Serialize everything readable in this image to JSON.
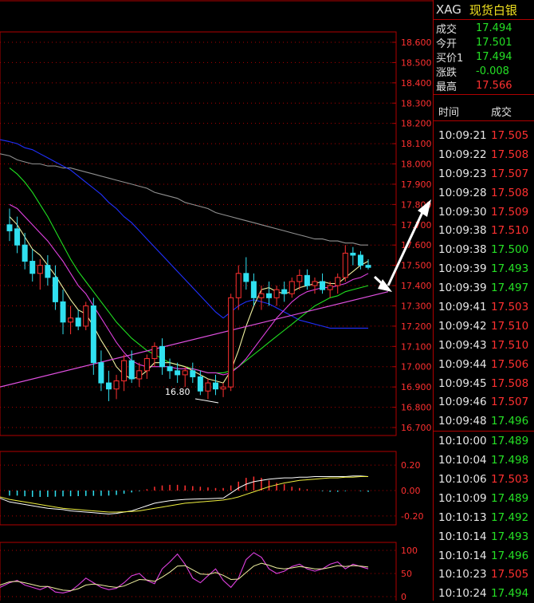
{
  "header": {
    "symbol": "XAG",
    "name": "现货白银"
  },
  "quote": [
    {
      "label": "成交",
      "value": "17.494",
      "color": "green"
    },
    {
      "label": "今开",
      "value": "17.501",
      "color": "green"
    },
    {
      "label": "买价1",
      "value": "17.494",
      "color": "green"
    },
    {
      "label": "涨跌",
      "value": "-0.008",
      "color": "green"
    },
    {
      "label": "最高",
      "value": "17.566",
      "color": "red"
    }
  ],
  "ticks_header": {
    "time": "时间",
    "price": "成交"
  },
  "ticks": [
    {
      "time": "10:09:21",
      "price": "17.505",
      "color": "red"
    },
    {
      "time": "10:09:22",
      "price": "17.508",
      "color": "red"
    },
    {
      "time": "10:09:23",
      "price": "17.507",
      "color": "red"
    },
    {
      "time": "10:09:28",
      "price": "17.508",
      "color": "red"
    },
    {
      "time": "10:09:30",
      "price": "17.509",
      "color": "red"
    },
    {
      "time": "10:09:38",
      "price": "17.510",
      "color": "red"
    },
    {
      "time": "10:09:38",
      "price": "17.500",
      "color": "green"
    },
    {
      "time": "10:09:39",
      "price": "17.493",
      "color": "green"
    },
    {
      "time": "10:09:39",
      "price": "17.497",
      "color": "green"
    },
    {
      "time": "10:09:41",
      "price": "17.503",
      "color": "red"
    },
    {
      "time": "10:09:42",
      "price": "17.510",
      "color": "red"
    },
    {
      "time": "10:09:43",
      "price": "17.510",
      "color": "red"
    },
    {
      "time": "10:09:44",
      "price": "17.506",
      "color": "red"
    },
    {
      "time": "10:09:45",
      "price": "17.508",
      "color": "red"
    },
    {
      "time": "10:09:46",
      "price": "17.507",
      "color": "red"
    },
    {
      "time": "10:09:48",
      "price": "17.496",
      "color": "green"
    },
    {
      "time": "10:10:00",
      "price": "17.489",
      "color": "green"
    },
    {
      "time": "10:10:04",
      "price": "17.498",
      "color": "green"
    },
    {
      "time": "10:10:06",
      "price": "17.503",
      "color": "red"
    },
    {
      "time": "10:10:09",
      "price": "17.489",
      "color": "green"
    },
    {
      "time": "10:10:13",
      "price": "17.492",
      "color": "green"
    },
    {
      "time": "10:10:14",
      "price": "17.493",
      "color": "green"
    },
    {
      "time": "10:10:14",
      "price": "17.496",
      "color": "green"
    },
    {
      "time": "10:10:23",
      "price": "17.505",
      "color": "red"
    },
    {
      "time": "10:10:24",
      "price": "17.494",
      "color": "green"
    }
  ],
  "price_axis": [
    "18.600",
    "18.500",
    "18.400",
    "18.300",
    "18.200",
    "18.100",
    "18.000",
    "17.900",
    "17.800",
    "17.700",
    "17.600",
    "17.500",
    "17.400",
    "17.300",
    "17.200",
    "17.100",
    "17.000",
    "16.900",
    "16.800",
    "16.700"
  ],
  "low_label": "16.80",
  "macd_axis": [
    "0.20",
    "0.00",
    "-0.20"
  ],
  "kdj_axis": [
    "100",
    "50",
    "0"
  ],
  "colors": {
    "up": "#ff3030",
    "down": "#30e0f0",
    "grid": "#b00000",
    "ma5": "#f0f0a0",
    "ma10": "#e040e0",
    "ma20": "#20e020",
    "ma60": "#2030ff",
    "ma120": "#909090"
  },
  "chart_data": {
    "type": "candlestick",
    "ylim": [
      16.7,
      18.65
    ],
    "candles": [
      {
        "o": 17.7,
        "h": 17.78,
        "l": 17.62,
        "c": 17.67
      },
      {
        "o": 17.68,
        "h": 17.74,
        "l": 17.56,
        "c": 17.6
      },
      {
        "o": 17.6,
        "h": 17.66,
        "l": 17.48,
        "c": 17.52
      },
      {
        "o": 17.52,
        "h": 17.58,
        "l": 17.42,
        "c": 17.46
      },
      {
        "o": 17.46,
        "h": 17.53,
        "l": 17.38,
        "c": 17.5
      },
      {
        "o": 17.5,
        "h": 17.55,
        "l": 17.4,
        "c": 17.44
      },
      {
        "o": 17.44,
        "h": 17.5,
        "l": 17.28,
        "c": 17.32
      },
      {
        "o": 17.32,
        "h": 17.38,
        "l": 17.16,
        "c": 17.22
      },
      {
        "o": 17.22,
        "h": 17.3,
        "l": 17.16,
        "c": 17.24
      },
      {
        "o": 17.24,
        "h": 17.28,
        "l": 17.18,
        "c": 17.2
      },
      {
        "o": 17.2,
        "h": 17.32,
        "l": 17.18,
        "c": 17.3
      },
      {
        "o": 17.3,
        "h": 17.34,
        "l": 16.96,
        "c": 17.02
      },
      {
        "o": 17.02,
        "h": 17.08,
        "l": 16.88,
        "c": 16.92
      },
      {
        "o": 16.92,
        "h": 16.98,
        "l": 16.83,
        "c": 16.89
      },
      {
        "o": 16.89,
        "h": 16.96,
        "l": 16.84,
        "c": 16.93
      },
      {
        "o": 16.93,
        "h": 17.06,
        "l": 16.88,
        "c": 17.03
      },
      {
        "o": 17.03,
        "h": 17.08,
        "l": 16.92,
        "c": 16.94
      },
      {
        "o": 16.94,
        "h": 17.02,
        "l": 16.9,
        "c": 16.98
      },
      {
        "o": 16.98,
        "h": 17.06,
        "l": 16.94,
        "c": 17.04
      },
      {
        "o": 17.04,
        "h": 17.12,
        "l": 17.0,
        "c": 17.1
      },
      {
        "o": 17.1,
        "h": 17.14,
        "l": 16.96,
        "c": 17.0
      },
      {
        "o": 17.0,
        "h": 17.04,
        "l": 16.94,
        "c": 16.98
      },
      {
        "o": 16.98,
        "h": 17.02,
        "l": 16.92,
        "c": 16.96
      },
      {
        "o": 16.96,
        "h": 17.0,
        "l": 16.9,
        "c": 16.98
      },
      {
        "o": 16.98,
        "h": 17.02,
        "l": 16.92,
        "c": 16.95
      },
      {
        "o": 16.95,
        "h": 16.98,
        "l": 16.86,
        "c": 16.88
      },
      {
        "o": 16.88,
        "h": 16.94,
        "l": 16.84,
        "c": 16.92
      },
      {
        "o": 16.92,
        "h": 16.96,
        "l": 16.86,
        "c": 16.89
      },
      {
        "o": 16.89,
        "h": 16.92,
        "l": 16.85,
        "c": 16.9
      },
      {
        "o": 16.9,
        "h": 17.36,
        "l": 16.88,
        "c": 17.34
      },
      {
        "o": 17.34,
        "h": 17.5,
        "l": 17.28,
        "c": 17.46
      },
      {
        "o": 17.46,
        "h": 17.54,
        "l": 17.38,
        "c": 17.42
      },
      {
        "o": 17.42,
        "h": 17.46,
        "l": 17.3,
        "c": 17.34
      },
      {
        "o": 17.34,
        "h": 17.4,
        "l": 17.28,
        "c": 17.36
      },
      {
        "o": 17.36,
        "h": 17.42,
        "l": 17.3,
        "c": 17.34
      },
      {
        "o": 17.34,
        "h": 17.4,
        "l": 17.3,
        "c": 17.38
      },
      {
        "o": 17.38,
        "h": 17.42,
        "l": 17.32,
        "c": 17.36
      },
      {
        "o": 17.36,
        "h": 17.44,
        "l": 17.34,
        "c": 17.42
      },
      {
        "o": 17.42,
        "h": 17.48,
        "l": 17.38,
        "c": 17.45
      },
      {
        "o": 17.45,
        "h": 17.48,
        "l": 17.38,
        "c": 17.4
      },
      {
        "o": 17.4,
        "h": 17.44,
        "l": 17.36,
        "c": 17.42
      },
      {
        "o": 17.42,
        "h": 17.46,
        "l": 17.36,
        "c": 17.38
      },
      {
        "o": 17.38,
        "h": 17.42,
        "l": 17.34,
        "c": 17.4
      },
      {
        "o": 17.4,
        "h": 17.46,
        "l": 17.36,
        "c": 17.44
      },
      {
        "o": 17.44,
        "h": 17.6,
        "l": 17.42,
        "c": 17.56
      },
      {
        "o": 17.56,
        "h": 17.59,
        "l": 17.5,
        "c": 17.55
      },
      {
        "o": 17.55,
        "h": 17.57,
        "l": 17.48,
        "c": 17.5
      },
      {
        "o": 17.5,
        "h": 17.53,
        "l": 17.48,
        "c": 17.49
      }
    ],
    "ma5": [
      17.74,
      17.7,
      17.64,
      17.58,
      17.55,
      17.5,
      17.45,
      17.39,
      17.33,
      17.28,
      17.26,
      17.2,
      17.13,
      17.07,
      17.0,
      16.96,
      16.94,
      16.95,
      16.98,
      17.02,
      17.02,
      17.02,
      17.01,
      17.0,
      16.98,
      16.96,
      16.94,
      16.93,
      16.92,
      16.98,
      17.08,
      17.2,
      17.3,
      17.38,
      17.39,
      17.37,
      17.36,
      17.37,
      17.39,
      17.4,
      17.41,
      17.42,
      17.41,
      17.41,
      17.44,
      17.47,
      17.5,
      17.52
    ],
    "ma10": [
      17.8,
      17.78,
      17.74,
      17.7,
      17.66,
      17.62,
      17.57,
      17.52,
      17.46,
      17.4,
      17.36,
      17.3,
      17.24,
      17.18,
      17.12,
      17.07,
      17.03,
      17.01,
      17.0,
      17.0,
      17.0,
      17.0,
      16.99,
      16.99,
      16.99,
      16.98,
      16.97,
      16.97,
      16.96,
      16.97,
      17.0,
      17.04,
      17.09,
      17.14,
      17.19,
      17.24,
      17.28,
      17.32,
      17.35,
      17.37,
      17.38,
      17.39,
      17.39,
      17.4,
      17.41,
      17.43,
      17.44,
      17.46
    ],
    "ma20": [
      17.98,
      17.95,
      17.91,
      17.86,
      17.8,
      17.74,
      17.67,
      17.6,
      17.53,
      17.47,
      17.42,
      17.37,
      17.32,
      17.27,
      17.22,
      17.18,
      17.14,
      17.11,
      17.08,
      17.06,
      17.04,
      17.02,
      17.01,
      17.0,
      16.99,
      16.98,
      16.97,
      16.97,
      16.97,
      16.98,
      17.0,
      17.03,
      17.06,
      17.09,
      17.12,
      17.15,
      17.18,
      17.21,
      17.24,
      17.27,
      17.3,
      17.32,
      17.34,
      17.35,
      17.37,
      17.38,
      17.39,
      17.4
    ],
    "ma60": [
      18.11,
      18.1,
      18.08,
      18.07,
      18.05,
      18.03,
      18.01,
      17.99,
      17.97,
      17.94,
      17.91,
      17.88,
      17.85,
      17.81,
      17.78,
      17.74,
      17.71,
      17.67,
      17.63,
      17.59,
      17.55,
      17.51,
      17.47,
      17.43,
      17.39,
      17.35,
      17.31,
      17.27,
      17.24,
      17.27,
      17.3,
      17.32,
      17.33,
      17.32,
      17.31,
      17.29,
      17.27,
      17.25,
      17.23,
      17.22,
      17.21,
      17.2,
      17.19,
      17.19,
      17.19,
      17.19,
      17.19,
      17.19
    ],
    "ma120": [
      18.04,
      18.02,
      18.01,
      18.0,
      18.0,
      17.99,
      17.99,
      17.98,
      17.98,
      17.97,
      17.96,
      17.95,
      17.94,
      17.93,
      17.92,
      17.91,
      17.9,
      17.89,
      17.88,
      17.86,
      17.85,
      17.84,
      17.83,
      17.81,
      17.8,
      17.79,
      17.78,
      17.76,
      17.75,
      17.74,
      17.73,
      17.72,
      17.71,
      17.7,
      17.69,
      17.68,
      17.67,
      17.66,
      17.65,
      17.64,
      17.63,
      17.63,
      17.62,
      17.62,
      17.61,
      17.61,
      17.6,
      17.6
    ],
    "trendline": [
      [
        16.9,
        17.4
      ]
    ],
    "macd_hist": [
      -0.04,
      -0.04,
      -0.045,
      -0.05,
      -0.05,
      -0.05,
      -0.048,
      -0.046,
      -0.045,
      -0.044,
      -0.043,
      -0.042,
      -0.042,
      -0.04,
      -0.035,
      -0.025,
      -0.015,
      -0.005,
      0.01,
      0.03,
      0.04,
      0.045,
      0.045,
      0.04,
      0.035,
      0.03,
      0.025,
      0.02,
      0.02,
      0.04,
      0.07,
      0.1,
      0.11,
      0.1,
      0.08,
      0.06,
      0.05,
      0.03,
      0.02,
      0.01,
      0.0,
      -0.005,
      -0.01,
      -0.01,
      -0.005,
      0.0,
      -0.005,
      -0.01
    ],
    "macd_dif": [
      -0.09,
      -0.1,
      -0.11,
      -0.12,
      -0.13,
      -0.14,
      -0.145,
      -0.15,
      -0.16,
      -0.165,
      -0.17,
      -0.175,
      -0.18,
      -0.185,
      -0.18,
      -0.17,
      -0.16,
      -0.14,
      -0.12,
      -0.1,
      -0.09,
      -0.08,
      -0.075,
      -0.07,
      -0.068,
      -0.066,
      -0.064,
      -0.062,
      -0.06,
      -0.02,
      0.02,
      0.05,
      0.07,
      0.08,
      0.09,
      0.095,
      0.1,
      0.1,
      0.105,
      0.105,
      0.11,
      0.11,
      0.11,
      0.11,
      0.11,
      0.115,
      0.115,
      0.11
    ],
    "macd_dea": [
      -0.07,
      -0.08,
      -0.09,
      -0.1,
      -0.11,
      -0.12,
      -0.13,
      -0.14,
      -0.145,
      -0.15,
      -0.155,
      -0.16,
      -0.165,
      -0.17,
      -0.17,
      -0.168,
      -0.165,
      -0.16,
      -0.15,
      -0.14,
      -0.13,
      -0.12,
      -0.11,
      -0.1,
      -0.095,
      -0.09,
      -0.085,
      -0.08,
      -0.075,
      -0.065,
      -0.05,
      -0.03,
      -0.01,
      0.01,
      0.03,
      0.045,
      0.06,
      0.07,
      0.08,
      0.085,
      0.09,
      0.095,
      0.1,
      0.1,
      0.105,
      0.105,
      0.11,
      0.11
    ],
    "kdj_k": [
      30,
      35,
      25,
      20,
      15,
      22,
      10,
      8,
      12,
      25,
      40,
      30,
      20,
      15,
      18,
      30,
      45,
      50,
      35,
      28,
      60,
      75,
      92,
      70,
      40,
      30,
      45,
      60,
      35,
      20,
      40,
      80,
      95,
      85,
      60,
      50,
      55,
      65,
      70,
      60,
      55,
      60,
      70,
      75,
      60,
      70,
      65,
      60
    ],
    "kdj_d": [
      32,
      33,
      30,
      26,
      22,
      22,
      18,
      14,
      13,
      17,
      25,
      27,
      25,
      22,
      20,
      23,
      30,
      37,
      36,
      33,
      42,
      53,
      66,
      67,
      58,
      49,
      48,
      52,
      46,
      37,
      38,
      52,
      66,
      72,
      68,
      62,
      60,
      62,
      65,
      63,
      60,
      60,
      63,
      67,
      65,
      67,
      66,
      64
    ]
  }
}
